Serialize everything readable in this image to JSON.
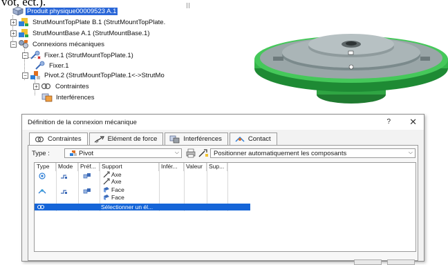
{
  "cut_text": "vot, ect.).",
  "tree": {
    "root_label": "Produit physique00009523 A.1",
    "items": [
      {
        "label": "StrutMountTopPlate B.1 (StrutMountTopPlate."
      },
      {
        "label": "StrutMountBase A.1 (StrutMountBase.1)"
      },
      {
        "label": "Connexions mécaniques"
      },
      {
        "label": "Fixer.1 (StrutMountTopPlate.1)"
      },
      {
        "label": "Fixer.1"
      },
      {
        "label": "Pivot.2 (StrutMountTopPlate.1<->StrutMo"
      },
      {
        "label": "Contraintes"
      },
      {
        "label": "Interférences"
      }
    ]
  },
  "dialog": {
    "title": "Définition de la connexion mécanique",
    "help": "?",
    "close": "✕",
    "tabs": [
      {
        "label": "Contraintes"
      },
      {
        "label": "Elément de force"
      },
      {
        "label": "Interférences"
      },
      {
        "label": "Contact"
      }
    ],
    "type_label": "Type :",
    "type_value": "Pivot",
    "position_value": "Positionner automatiquement les composants",
    "grid": {
      "headers": [
        "Type",
        "Mode",
        "Préf...",
        "Support",
        "Infér...",
        "Valeur",
        "Sup..."
      ],
      "support_values": [
        "Axe",
        "Axe",
        "Face",
        "Face"
      ],
      "selected_row_text": "Sélectionner un él..."
    }
  },
  "colors": {
    "selection": "#2a67d8",
    "grid_selection": "#1565d8",
    "part_green": "#2fb84a",
    "part_gray": "#9aa6a8"
  }
}
